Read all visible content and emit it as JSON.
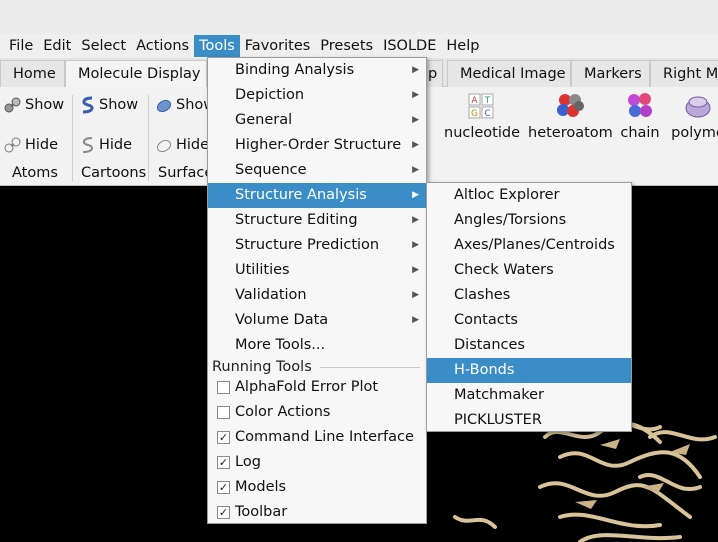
{
  "menubar": {
    "items": [
      "File",
      "Edit",
      "Select",
      "Actions",
      "Tools",
      "Favorites",
      "Presets",
      "ISOLDE",
      "Help"
    ]
  },
  "tabs": [
    "Home",
    "Molecule Display",
    "p",
    "Medical Image",
    "Markers",
    "Right Mo"
  ],
  "toolbar": {
    "atoms": {
      "show": "Show",
      "hide": "Hide",
      "label": "Atoms"
    },
    "cartoons": {
      "show": "Show",
      "hide": "Hide",
      "label": "Cartoons"
    },
    "surfaces": {
      "show": "Show",
      "hide": "Hide",
      "label": "Surface"
    },
    "color_buttons": [
      "nucleotide",
      "heteroatom",
      "chain",
      "polyme"
    ],
    "nucleotide_icon_letters": [
      "A",
      "T",
      "G",
      "C"
    ]
  },
  "tools_menu": {
    "items": [
      {
        "label": "Binding Analysis",
        "submenu": true
      },
      {
        "label": "Depiction",
        "submenu": true
      },
      {
        "label": "General",
        "submenu": true
      },
      {
        "label": "Higher-Order Structure",
        "submenu": true
      },
      {
        "label": "Sequence",
        "submenu": true
      },
      {
        "label": "Structure Analysis",
        "submenu": true
      },
      {
        "label": "Structure Editing",
        "submenu": true
      },
      {
        "label": "Structure Prediction",
        "submenu": true
      },
      {
        "label": "Utilities",
        "submenu": true
      },
      {
        "label": "Validation",
        "submenu": true
      },
      {
        "label": "Volume Data",
        "submenu": true
      },
      {
        "label": "More Tools...",
        "submenu": false
      }
    ],
    "running_tools_label": "Running Tools",
    "running_tools": [
      {
        "label": "AlphaFold Error Plot",
        "checked": false
      },
      {
        "label": "Color Actions",
        "checked": false
      },
      {
        "label": "Command Line Interface",
        "checked": true
      },
      {
        "label": "Log",
        "checked": true
      },
      {
        "label": "Models",
        "checked": true
      },
      {
        "label": "Toolbar",
        "checked": true
      }
    ]
  },
  "structure_analysis_menu": {
    "items": [
      "Altloc Explorer",
      "Angles/Torsions",
      "Axes/Planes/Centroids",
      "Check Waters",
      "Clashes",
      "Contacts",
      "Distances",
      "H-Bonds",
      "Matchmaker",
      "PICKLUSTER"
    ]
  },
  "colors": {
    "accent": "#3a8dc6",
    "viewport": "#000000",
    "ribbon": "#d9c49a"
  }
}
